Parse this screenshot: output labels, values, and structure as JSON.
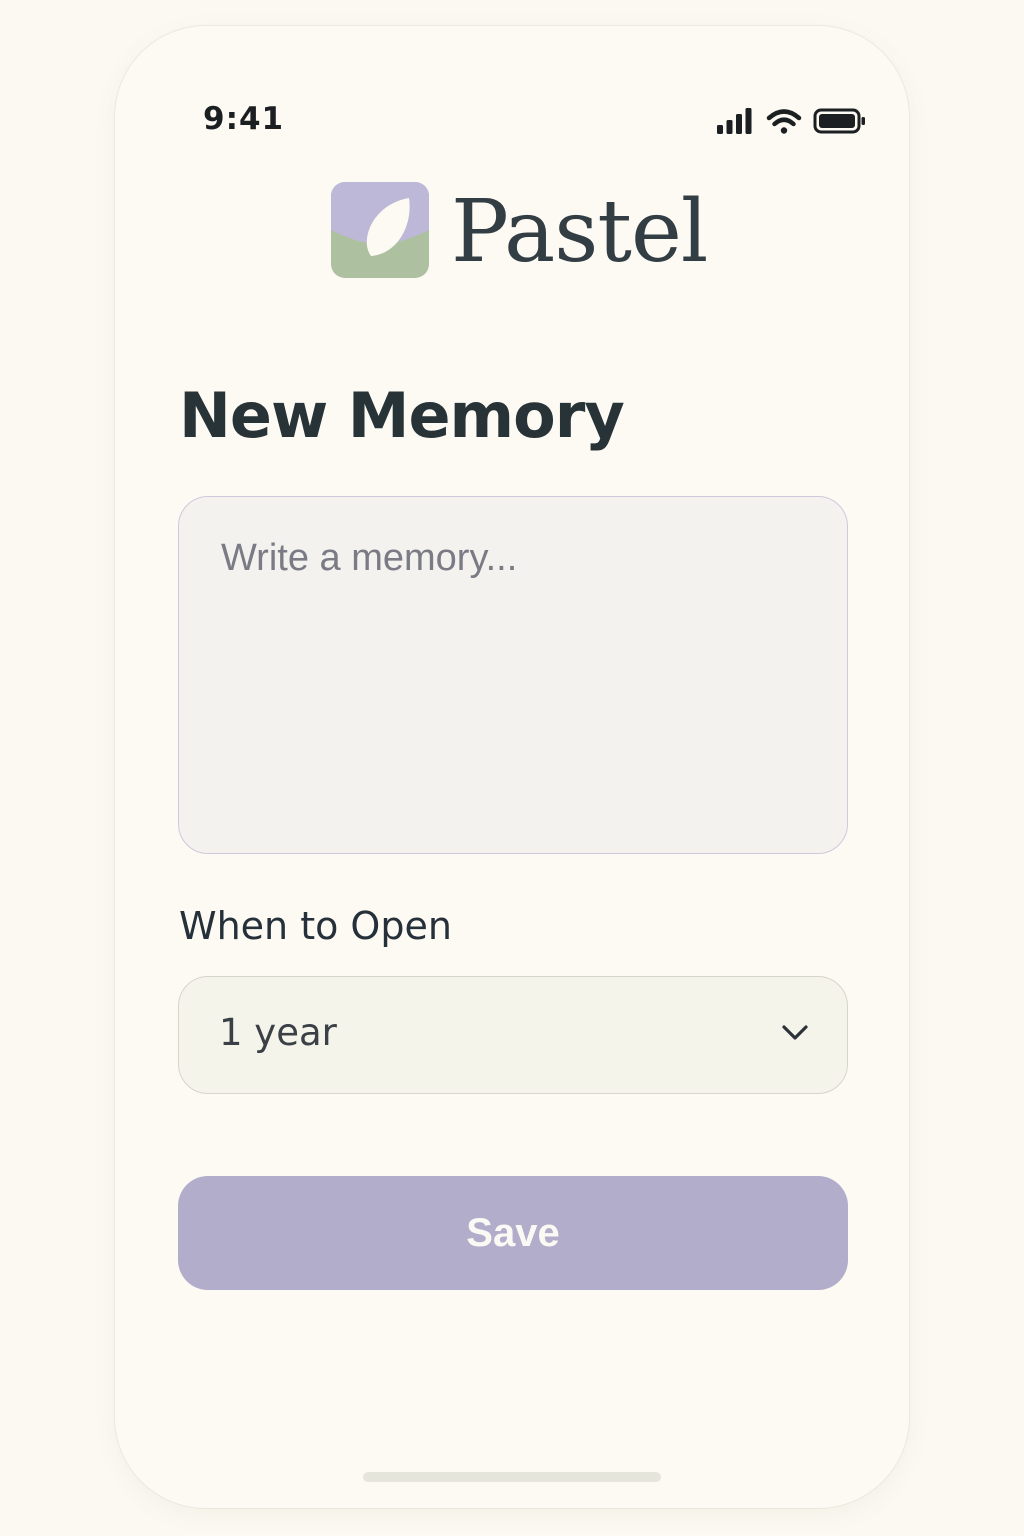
{
  "status_bar": {
    "time": "9:41",
    "icons": [
      "cellular-signal-icon",
      "wifi-icon",
      "battery-icon"
    ]
  },
  "app": {
    "name": "Pastel",
    "logo_icon": "pastel-logo-icon",
    "logo_colors": {
      "top": "#bdb8d8",
      "bottom": "#adc0a0",
      "leaf": "#fcfaf2"
    }
  },
  "form": {
    "title": "New Memory",
    "memory": {
      "placeholder": "Write a memory...",
      "value": ""
    },
    "open_when": {
      "label": "When to Open",
      "selected": "1 year",
      "icon": "chevron-down-icon"
    },
    "save_label": "Save"
  },
  "colors": {
    "background": "#fcfaf2",
    "accent": "#b1adcb",
    "text_primary": "#283338"
  }
}
